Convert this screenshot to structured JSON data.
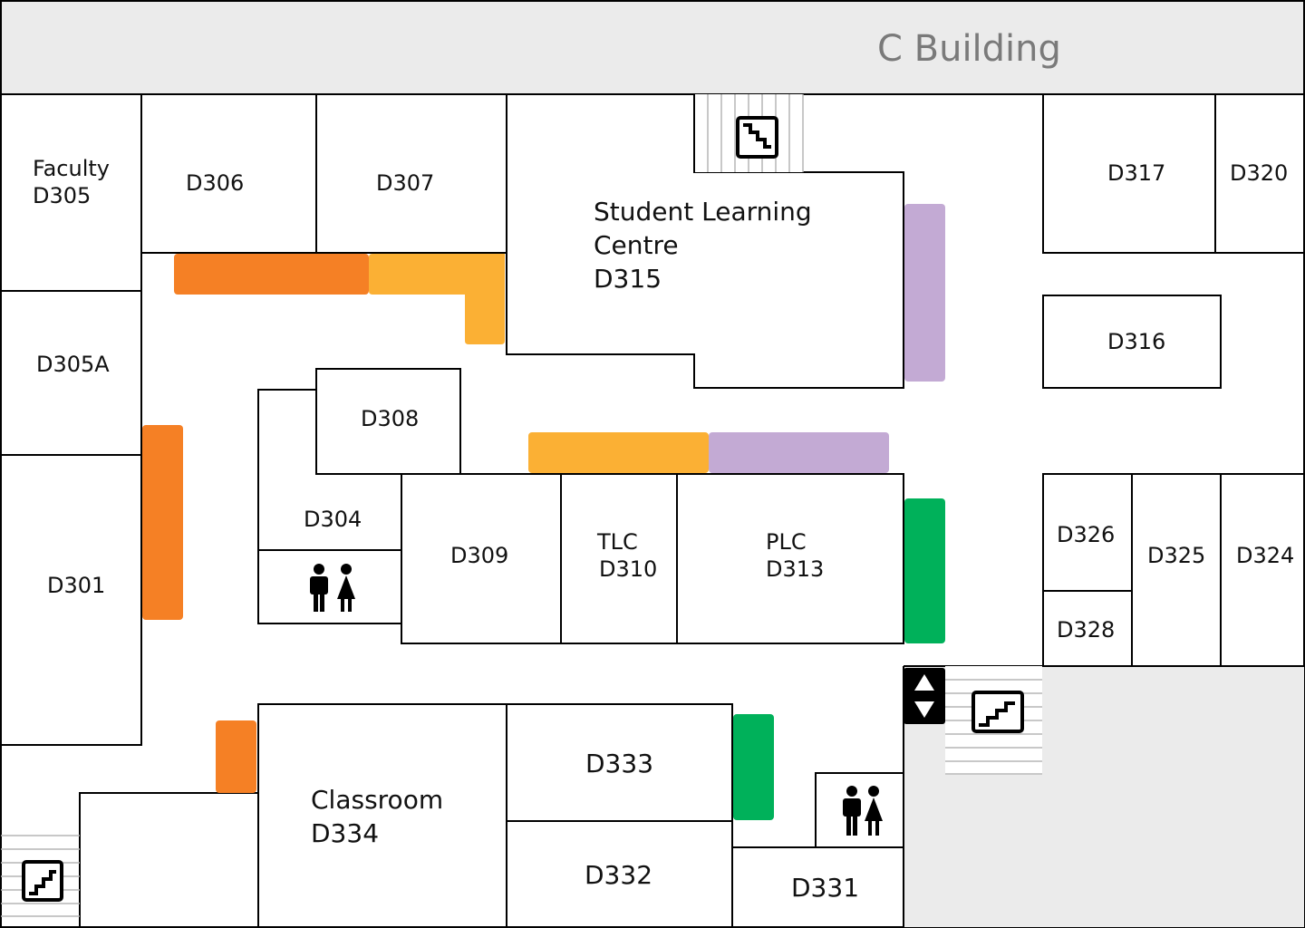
{
  "header": {
    "title": "C Building"
  },
  "rooms": {
    "d305": {
      "line1": "Faculty",
      "line2": "D305"
    },
    "d305a": "D305A",
    "d301": "D301",
    "d306": "D306",
    "d307": "D307",
    "d315": {
      "line1": "Student Learning",
      "line2": "Centre",
      "line3": "D315"
    },
    "d308": "D308",
    "d304": "D304",
    "d309": "D309",
    "d310": {
      "line1": "TLC",
      "line2": "D310"
    },
    "d313": {
      "line1": "PLC",
      "line2": "D313"
    },
    "d317": "D317",
    "d320": "D320",
    "d316": "D316",
    "d326": "D326",
    "d328": "D328",
    "d325": "D325",
    "d324": "D324",
    "d334": {
      "line1": "Classroom",
      "line2": "D334"
    },
    "d333": "D333",
    "d332": "D332",
    "d331": "D331"
  },
  "colors": {
    "orange": "#f58025",
    "yellow": "#fbb034",
    "purple": "#c3aad4",
    "green": "#00b15a",
    "header_bg": "#ebebeb",
    "unused_area": "#ebebeb"
  },
  "icons": [
    "stairs-icon",
    "restroom-icon",
    "elevator-icon"
  ]
}
